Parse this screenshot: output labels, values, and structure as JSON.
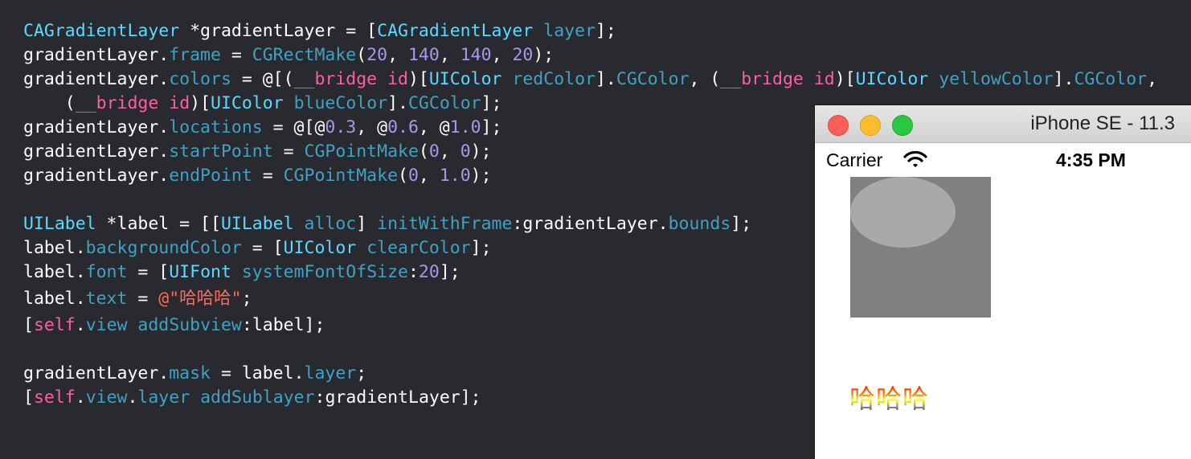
{
  "code": {
    "lines": [
      [
        [
          "type",
          "CAGradientLayer"
        ],
        [
          "plain",
          " *gradientLayer = ["
        ],
        [
          "type",
          "CAGradientLayer"
        ],
        [
          "plain",
          " "
        ],
        [
          "fn",
          "layer"
        ],
        [
          "plain",
          "];"
        ]
      ],
      [
        [
          "plain",
          "gradientLayer."
        ],
        [
          "prop",
          "frame"
        ],
        [
          "plain",
          " = "
        ],
        [
          "fn",
          "CGRectMake"
        ],
        [
          "plain",
          "("
        ],
        [
          "num",
          "20"
        ],
        [
          "plain",
          ", "
        ],
        [
          "num",
          "140"
        ],
        [
          "plain",
          ", "
        ],
        [
          "num",
          "140"
        ],
        [
          "plain",
          ", "
        ],
        [
          "num",
          "20"
        ],
        [
          "plain",
          ");"
        ]
      ],
      [
        [
          "plain",
          "gradientLayer."
        ],
        [
          "prop",
          "colors"
        ],
        [
          "plain",
          " = @[("
        ],
        [
          "kw",
          "__bridge"
        ],
        [
          "plain",
          " "
        ],
        [
          "kw",
          "id"
        ],
        [
          "plain",
          ")["
        ],
        [
          "type",
          "UIColor"
        ],
        [
          "plain",
          " "
        ],
        [
          "fn",
          "redColor"
        ],
        [
          "plain",
          "]."
        ],
        [
          "prop",
          "CGColor"
        ],
        [
          "plain",
          ", ("
        ],
        [
          "kw",
          "__bridge"
        ],
        [
          "plain",
          " "
        ],
        [
          "kw",
          "id"
        ],
        [
          "plain",
          ")["
        ],
        [
          "type",
          "UIColor"
        ],
        [
          "plain",
          " "
        ],
        [
          "fn",
          "yellowColor"
        ],
        [
          "plain",
          "]."
        ],
        [
          "prop",
          "CGColor"
        ],
        [
          "plain",
          ","
        ]
      ],
      [
        [
          "plain",
          "    ("
        ],
        [
          "kw",
          "__bridge"
        ],
        [
          "plain",
          " "
        ],
        [
          "kw",
          "id"
        ],
        [
          "plain",
          ")["
        ],
        [
          "type",
          "UIColor"
        ],
        [
          "plain",
          " "
        ],
        [
          "fn",
          "blueColor"
        ],
        [
          "plain",
          "]."
        ],
        [
          "prop",
          "CGColor"
        ],
        [
          "plain",
          "];"
        ]
      ],
      [
        [
          "plain",
          "gradientLayer."
        ],
        [
          "prop",
          "locations"
        ],
        [
          "plain",
          " = @[@"
        ],
        [
          "num",
          "0.3"
        ],
        [
          "plain",
          ", @"
        ],
        [
          "num",
          "0.6"
        ],
        [
          "plain",
          ", @"
        ],
        [
          "num",
          "1.0"
        ],
        [
          "plain",
          "];"
        ]
      ],
      [
        [
          "plain",
          "gradientLayer."
        ],
        [
          "prop",
          "startPoint"
        ],
        [
          "plain",
          " = "
        ],
        [
          "fn",
          "CGPointMake"
        ],
        [
          "plain",
          "("
        ],
        [
          "num",
          "0"
        ],
        [
          "plain",
          ", "
        ],
        [
          "num",
          "0"
        ],
        [
          "plain",
          ");"
        ]
      ],
      [
        [
          "plain",
          "gradientLayer."
        ],
        [
          "prop",
          "endPoint"
        ],
        [
          "plain",
          " = "
        ],
        [
          "fn",
          "CGPointMake"
        ],
        [
          "plain",
          "("
        ],
        [
          "num",
          "0"
        ],
        [
          "plain",
          ", "
        ],
        [
          "num",
          "1.0"
        ],
        [
          "plain",
          ");"
        ]
      ],
      [],
      [
        [
          "type",
          "UILabel"
        ],
        [
          "plain",
          " *label = [["
        ],
        [
          "type",
          "UILabel"
        ],
        [
          "plain",
          " "
        ],
        [
          "fn",
          "alloc"
        ],
        [
          "plain",
          "] "
        ],
        [
          "fn",
          "initWithFrame"
        ],
        [
          "plain",
          ":gradientLayer."
        ],
        [
          "prop",
          "bounds"
        ],
        [
          "plain",
          "];"
        ]
      ],
      [
        [
          "plain",
          "label."
        ],
        [
          "prop",
          "backgroundColor"
        ],
        [
          "plain",
          " = ["
        ],
        [
          "type",
          "UIColor"
        ],
        [
          "plain",
          " "
        ],
        [
          "fn",
          "clearColor"
        ],
        [
          "plain",
          "];"
        ]
      ],
      [
        [
          "plain",
          "label."
        ],
        [
          "prop",
          "font"
        ],
        [
          "plain",
          " = ["
        ],
        [
          "type",
          "UIFont"
        ],
        [
          "plain",
          " "
        ],
        [
          "fn",
          "systemFontOfSize"
        ],
        [
          "plain",
          ":"
        ],
        [
          "num",
          "20"
        ],
        [
          "plain",
          "];"
        ]
      ],
      [
        [
          "plain",
          "label."
        ],
        [
          "prop",
          "text"
        ],
        [
          "plain",
          " = "
        ],
        [
          "str",
          "@\"哈哈哈\""
        ],
        [
          "plain",
          ";"
        ]
      ],
      [
        [
          "plain",
          "["
        ],
        [
          "kw",
          "self"
        ],
        [
          "plain",
          "."
        ],
        [
          "prop",
          "view"
        ],
        [
          "plain",
          " "
        ],
        [
          "fn",
          "addSubview"
        ],
        [
          "plain",
          ":label];"
        ]
      ],
      [],
      [
        [
          "plain",
          "gradientLayer."
        ],
        [
          "prop",
          "mask"
        ],
        [
          "plain",
          " = label."
        ],
        [
          "prop",
          "layer"
        ],
        [
          "plain",
          ";"
        ]
      ],
      [
        [
          "plain",
          "["
        ],
        [
          "kw",
          "self"
        ],
        [
          "plain",
          "."
        ],
        [
          "prop",
          "view"
        ],
        [
          "plain",
          "."
        ],
        [
          "prop",
          "layer"
        ],
        [
          "plain",
          " "
        ],
        [
          "fn",
          "addSublayer"
        ],
        [
          "plain",
          ":gradientLayer];"
        ]
      ]
    ]
  },
  "simulator": {
    "title": "iPhone SE - 11.3",
    "carrier": "Carrier",
    "time": "4:35 PM",
    "label_text": "哈哈哈"
  },
  "colors": {
    "editor_bg": "#292a30",
    "gradient": [
      "#ff0000",
      "#ffff00",
      "#0000ff"
    ]
  }
}
